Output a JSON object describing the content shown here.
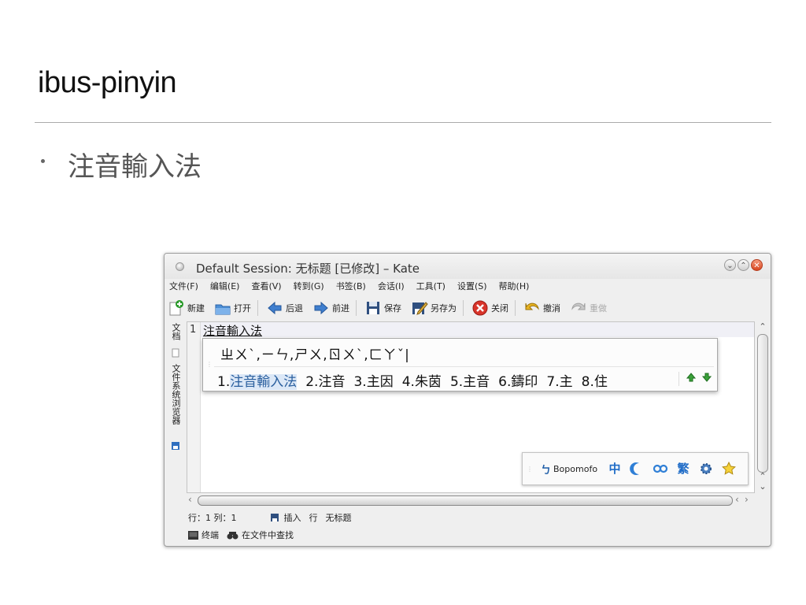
{
  "slide": {
    "title": "ibus-pinyin",
    "bullet": "注音輸入法"
  },
  "window": {
    "title": "Default Session: 无标题 [已修改] – Kate"
  },
  "menu": [
    "文件(F)",
    "编辑(E)",
    "查看(V)",
    "转到(G)",
    "书签(B)",
    "会话(I)",
    "工具(T)",
    "设置(S)",
    "帮助(H)"
  ],
  "toolbar": {
    "new": "新建",
    "open": "打开",
    "back": "后退",
    "forward": "前进",
    "save": "保存",
    "save_as": "另存为",
    "close": "关闭",
    "undo": "撤消",
    "redo": "重做"
  },
  "side_tabs": {
    "documents": "文档",
    "filesystem": "文件系统浏览器"
  },
  "editor": {
    "line_number": "1",
    "text": "注音輸入法"
  },
  "ime": {
    "preedit": "ㄓㄨˋ,ㄧㄣ,ㄕㄨ,ㄖㄨˋ,ㄈㄚˇ|",
    "candidates": [
      {
        "index": "1.",
        "word": "注音輸入法"
      },
      {
        "index": "2.",
        "word": "注音"
      },
      {
        "index": "3.",
        "word": "主因"
      },
      {
        "index": "4.",
        "word": "朱茵"
      },
      {
        "index": "5.",
        "word": "主音"
      },
      {
        "index": "6.",
        "word": "鑄印"
      },
      {
        "index": "7.",
        "word": "主"
      },
      {
        "index": "8.",
        "word": "住"
      }
    ]
  },
  "ime_panel": {
    "engine": "Bopomofo",
    "mode_glyph": "中",
    "traditional_glyph": "繁"
  },
  "status": {
    "position": "行：1 列：1",
    "mode": "插入",
    "line_mode": "行",
    "filename": "无标题"
  },
  "bottom_tabs": {
    "terminal": "终端",
    "find": "在文件中查找"
  },
  "colors": {
    "accent": "#2a5f9e",
    "selection": "#dce8f7",
    "close_button": "#d8451f"
  }
}
